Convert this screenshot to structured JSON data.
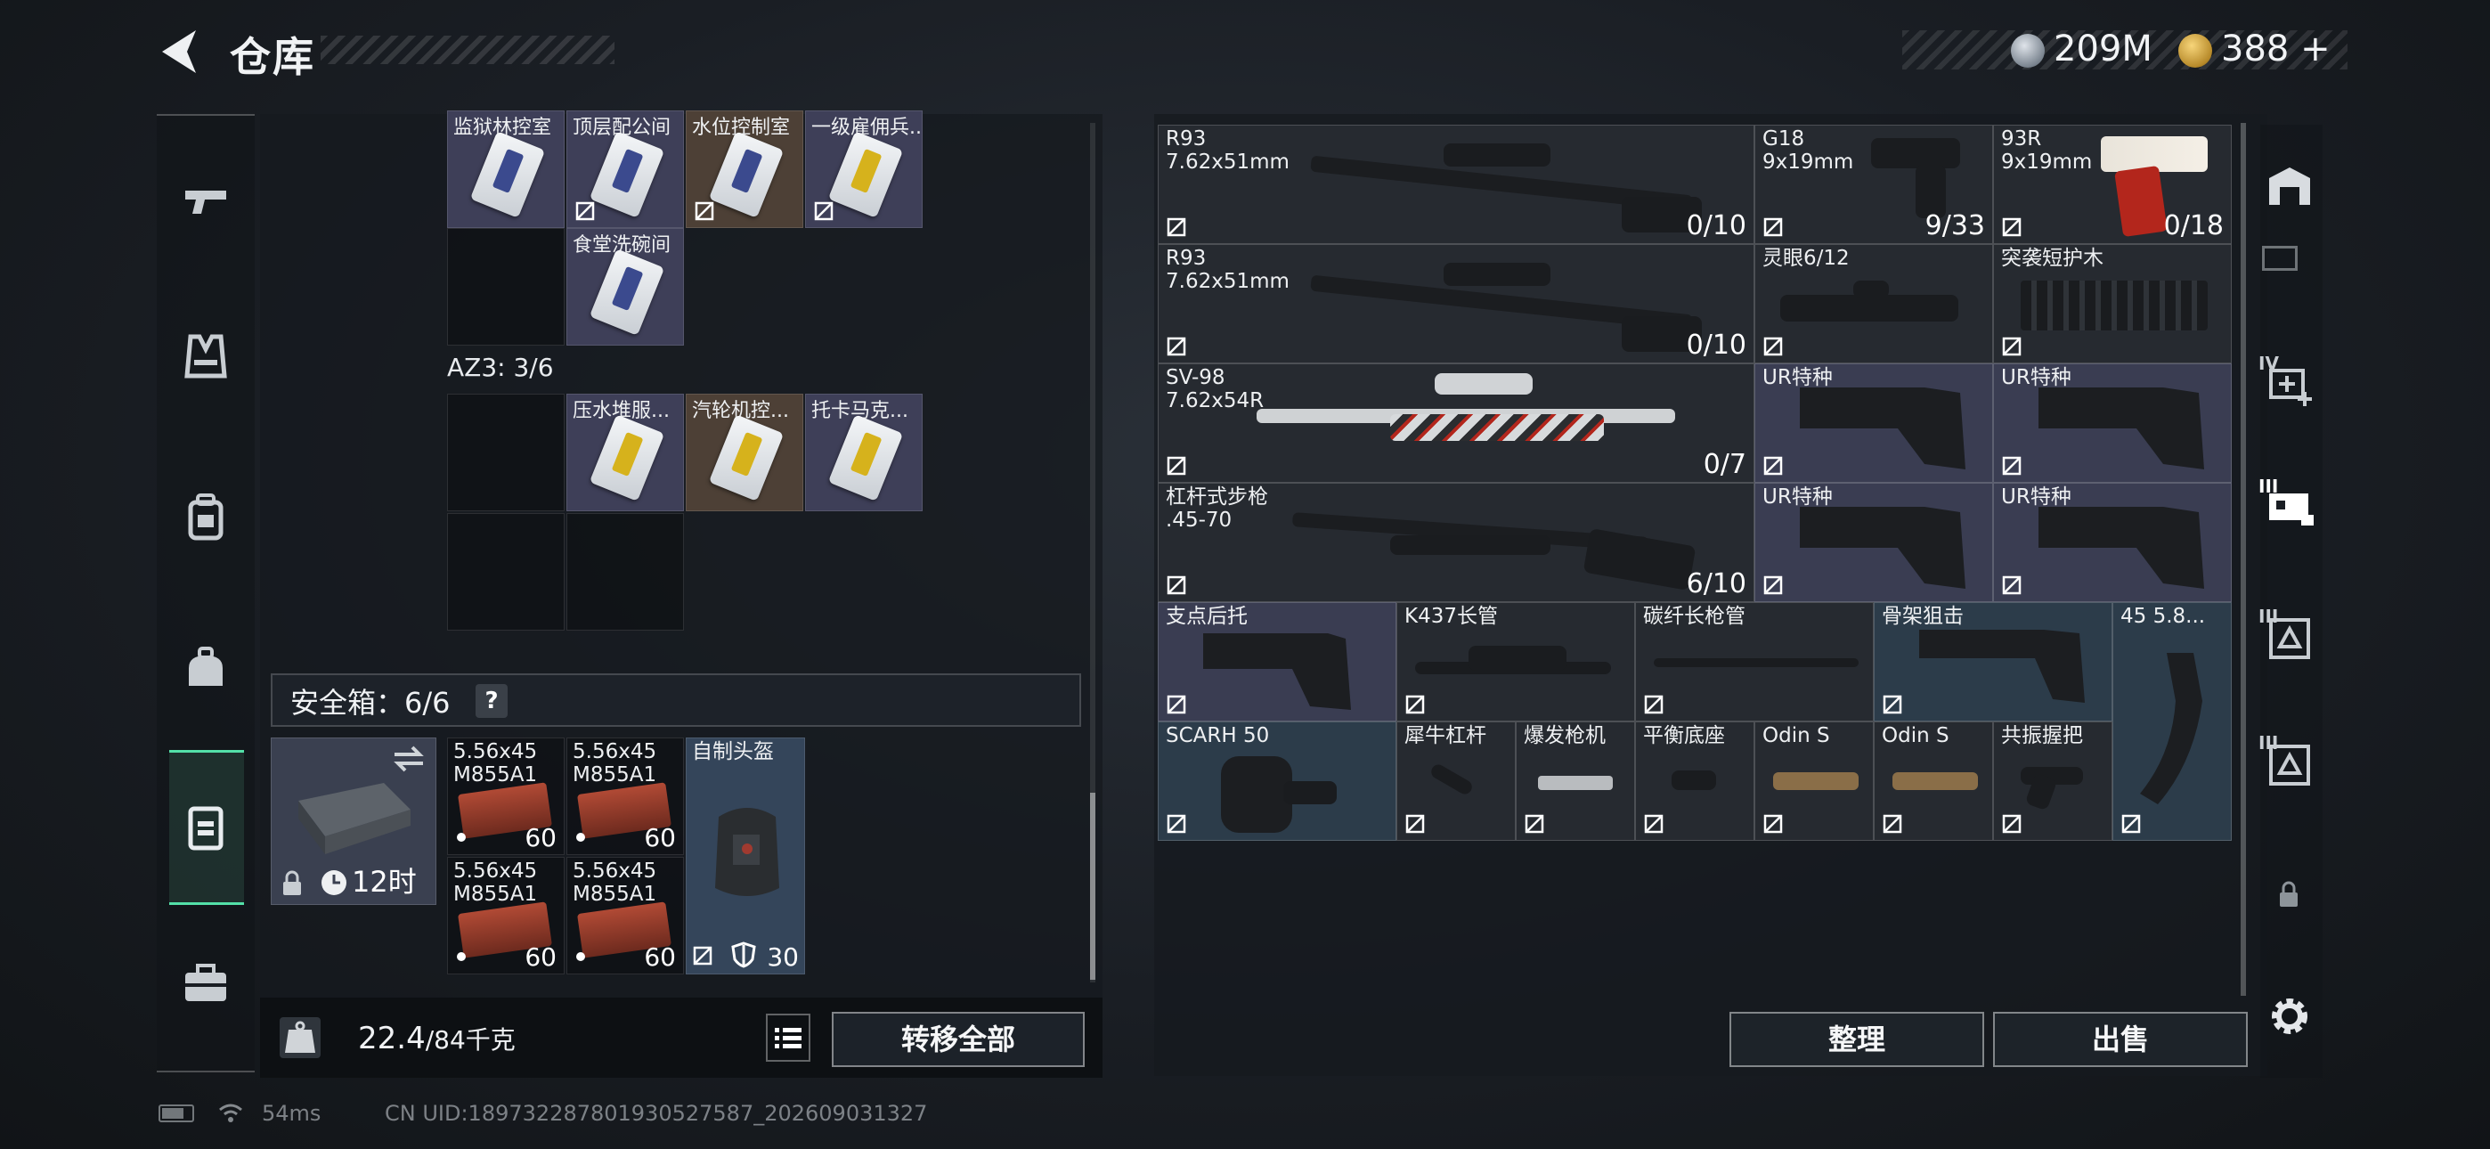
{
  "header": {
    "title": "仓库"
  },
  "currency": {
    "silver": "209M",
    "gold": "388",
    "gold_plus": "+"
  },
  "left_panel": {
    "top_row_labels": [
      "监狱林控室",
      "顶层配公间",
      "水位控制室",
      "一级雇佣兵..."
    ],
    "extra_card_label": "食堂洗碗间",
    "az3_label": "AZ3: 3/6",
    "az3_cells": [
      "压水堆服...",
      "汽轮机控...",
      "托卡马克..."
    ],
    "safe_label": "安全箱：6/6",
    "help": "?",
    "safe_timer": "12时",
    "pouch": [
      {
        "name": "5.56x45\nM855A1",
        "count": "60"
      },
      {
        "name": "5.56x45\nM855A1",
        "count": "60"
      },
      {
        "name": "5.56x45\nM855A1",
        "count": "60"
      },
      {
        "name": "5.56x45\nM855A1",
        "count": "60"
      }
    ],
    "helmet": {
      "name": "自制头盔",
      "durability": "30"
    },
    "weight_current": "22.4",
    "weight_total": "/84千克",
    "transfer_all": "转移全部"
  },
  "right_panel": {
    "row1": [
      {
        "name": "R93",
        "sub": "7.62x51mm",
        "count": "0/10"
      },
      {
        "name": "G18",
        "sub": "9x19mm",
        "count": "9/33"
      },
      {
        "name": "93R",
        "sub": "9x19mm",
        "count": "0/18"
      }
    ],
    "row2": [
      {
        "name": "R93",
        "sub": "7.62x51mm",
        "count": "0/10"
      },
      {
        "name": "灵眼6/12"
      },
      {
        "name": "突袭短护木"
      }
    ],
    "row3": [
      {
        "name": "SV-98",
        "sub": "7.62x54R",
        "count": "0/7"
      },
      {
        "name": "UR特种"
      },
      {
        "name": "UR特种"
      }
    ],
    "row4": [
      {
        "name": "杠杆式步枪",
        "sub": ".45-70",
        "count": "6/10"
      },
      {
        "name": "UR特种"
      },
      {
        "name": "UR特种"
      }
    ],
    "row5": [
      "支点后托",
      "K437长管",
      "碳纤长枪管",
      "骨架狙击",
      "45 5.8..."
    ],
    "row6": [
      "SCARH 50",
      "犀牛杠杆",
      "爆发枪机",
      "平衡底座",
      "Odin S",
      "Odin S",
      "共振握把"
    ],
    "sort_btn": "整理",
    "sell_btn": "出售"
  },
  "right_toolbar": {
    "tier4": "IV",
    "tier3a": "III",
    "tier3b": "III",
    "tier3c": "III"
  },
  "status": {
    "ping": "54ms",
    "uid": "CN UID:18973228780193052758​7_202609031327"
  },
  "colors": {
    "accent": "#53e0a8",
    "purple_cell": "#3e3f58",
    "brown_cell": "#4d4036"
  }
}
